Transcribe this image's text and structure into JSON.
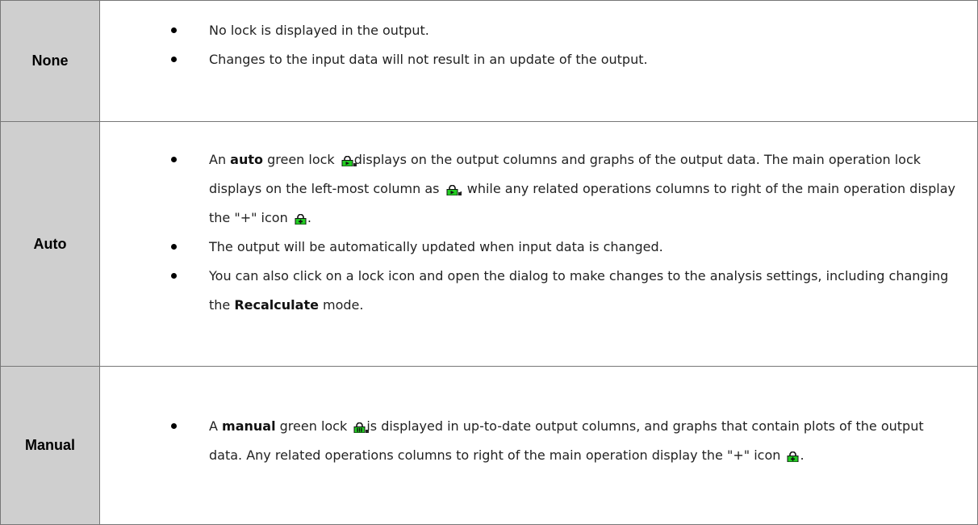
{
  "rows": [
    {
      "mode": "None",
      "items": [
        [
          "No lock is displayed in the output."
        ],
        [
          "Changes to the input data will not result in an update of the output."
        ]
      ]
    },
    {
      "mode": "Auto",
      "items": [
        [
          "An ",
          "auto",
          " green lock ",
          "displays on the output columns and graphs of the output data. The main operation lock displays on the left-most column as ",
          ", while any related operations columns to right of the main operation display the \"+\" icon ",
          "."
        ],
        [
          "The output will be automatically updated when input data is changed."
        ],
        [
          "You can also click on a lock icon and open the dialog to make changes to the analysis settings, including changing the ",
          "Recalculate",
          " mode."
        ]
      ]
    },
    {
      "mode": "Manual",
      "items": [
        [
          "A ",
          "manual",
          " green lock ",
          "is displayed in up-to-date output columns, and graphs that contain plots of the output data. Any related operations columns to right of the main operation display the \"+\" icon ",
          "."
        ]
      ]
    }
  ],
  "icons": {
    "auto": "auto-lock-icon",
    "manual": "manual-lock-icon",
    "plus": "plus-lock-icon"
  },
  "colors": {
    "lock_green": "#22cc22",
    "mode_cell_bg": "#cfcfcf"
  }
}
